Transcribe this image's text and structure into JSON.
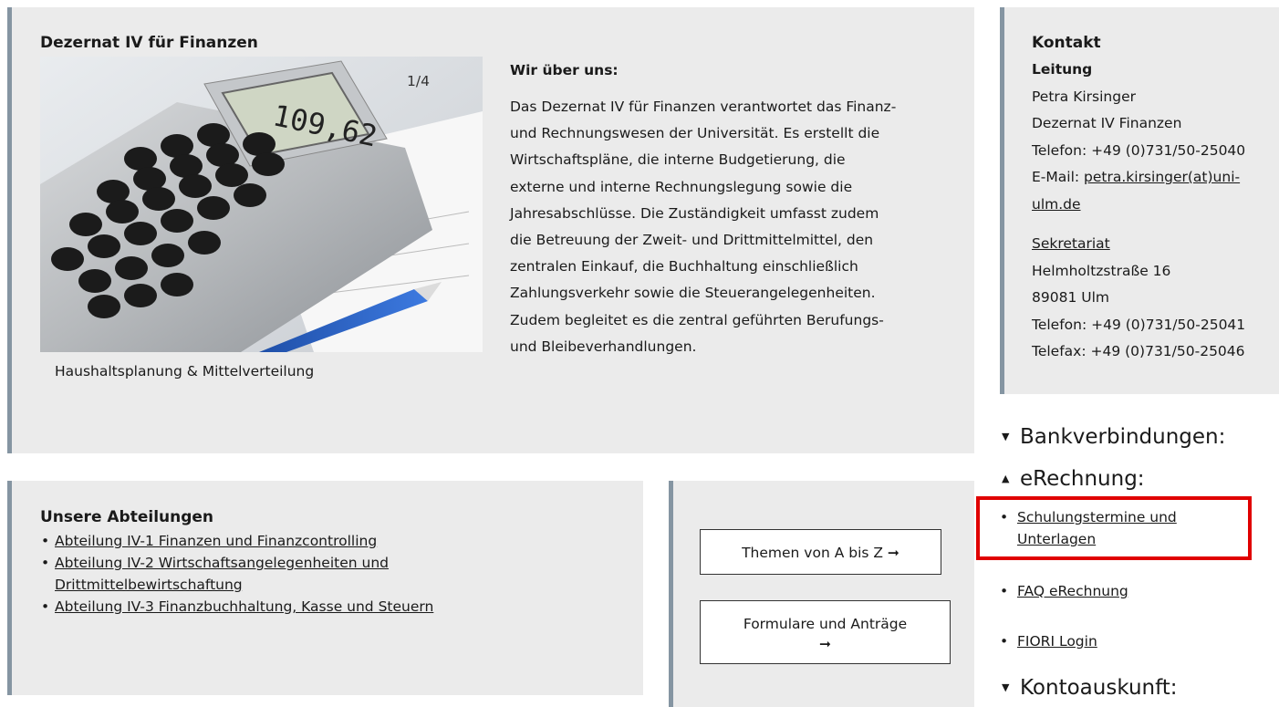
{
  "intro": {
    "title": "Dezernat IV für Finanzen",
    "slider_counter": "1/4",
    "slider_caption": "Haushaltsplanung & Mittelverteilung",
    "about_heading": "Wir über uns:",
    "about_lines": [
      "Das Dezernat IV für Finanzen verantwortet das Finanz-",
      "und Rechnungswesen der Universität. Es erstellt die",
      "Wirtschaftspläne, die interne Budgetierung, die",
      "externe und interne Rechnungslegung sowie die",
      "Jahresabschlüsse. Die Zuständigkeit umfasst zudem",
      "die Betreuung der Zweit- und Drittmittelmittel, den",
      "zentralen Einkauf, die Buchhaltung einschließlich",
      "Zahlungsverkehr sowie die Steuerangelegenheiten.",
      "Zudem begleitet es die zentral geführten Berufungs-",
      "und Bleibeverhandlungen."
    ]
  },
  "contact": {
    "heading": "Kontakt",
    "leitung_label": "Leitung",
    "name": "Petra Kirsinger",
    "unit": "Dezernat IV Finanzen",
    "phone": "Telefon: +49 (0)731/50-25040",
    "email_label": "E-Mail: ",
    "email_link_part1": "petra.kirsinger(at)uni-",
    "email_link_part2": "ulm.de",
    "secretariat_link": "Sekretariat",
    "street": "Helmholtzstraße 16",
    "city": "89081 Ulm",
    "sec_phone": "Telefon: +49 (0)731/50-25041",
    "sec_fax": "Telefax: +49 (0)731/50-25046"
  },
  "departments": {
    "heading": "Unsere Abteilungen",
    "items": [
      "Abteilung IV-1 Finanzen und Finanzcontrolling",
      "Abteilung IV-2 Wirtschaftsangelegenheiten und Drittmittelbewirtschaftung",
      "Abteilung IV-3 Finanzbuchhaltung, Kasse und Steuern"
    ],
    "item2_line1": "Abteilung IV-2 Wirtschaftsangelegenheiten und",
    "item2_line2": "Drittmittelbewirtschaftung"
  },
  "buttons": {
    "themes": "Themen von A bis Z  ➞",
    "forms": "Formulare und Anträge",
    "arrow": "➞"
  },
  "accordion": {
    "bank": "Bankverbindungen:",
    "erechnung": "eRechnung:",
    "erechnung_links": {
      "schulung_line1": "Schulungstermine und",
      "schulung_line2": "Unterlagen",
      "faq": "FAQ eRechnung",
      "fiori": "FIORI Login"
    },
    "konto": "Kontoauskunft:"
  },
  "colors": {
    "panel_bg": "#ebebeb",
    "panel_border": "#8595a2",
    "highlight": "#e00000"
  }
}
